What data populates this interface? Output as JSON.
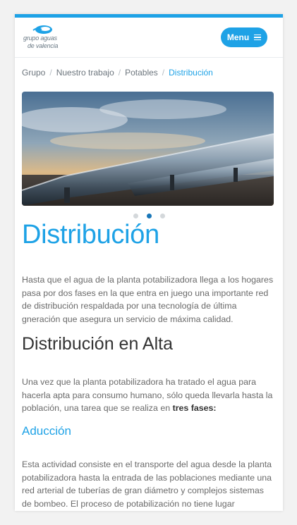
{
  "header": {
    "logo_line1": "grupo aguas",
    "logo_line2": "de valencia",
    "menu_label": "Menu"
  },
  "breadcrumb": {
    "items": [
      "Grupo",
      "Nuestro trabajo",
      "Potables"
    ],
    "current": "Distribución",
    "separator": "/"
  },
  "carousel": {
    "slide_count": 3,
    "active_index": 1
  },
  "content": {
    "title": "Distribución",
    "intro": "Hasta que el agua de la planta potabilizadora llega a los hogares pasa por dos fases en la que entra en juego una importante red de distribución respaldada por una tecnología de última gneración que asegura un servicio de máxima calidad.",
    "section_title": "Distribución en Alta",
    "section_text": "Una vez que la planta potabilizadora ha tratado el agua para hacerla apta para consumo humano, sólo queda llevarla hasta la población, una tarea que se realiza en",
    "section_text_bold": "tres fases:",
    "subsection_title": "Aducción",
    "subsection_text": "Esta actividad consiste en el transporte del agua desde la planta potabilizadora hasta la entrada de las poblaciones mediante una red arterial de tuberías de gran diámetro y complejos sistemas de bombeo. El proceso de potabilización no tiene lugar"
  },
  "colors": {
    "accent": "#1ea2e6",
    "dot_active": "#1876b8",
    "dot_inactive": "#d4d8db",
    "text": "#6a6a6a"
  }
}
